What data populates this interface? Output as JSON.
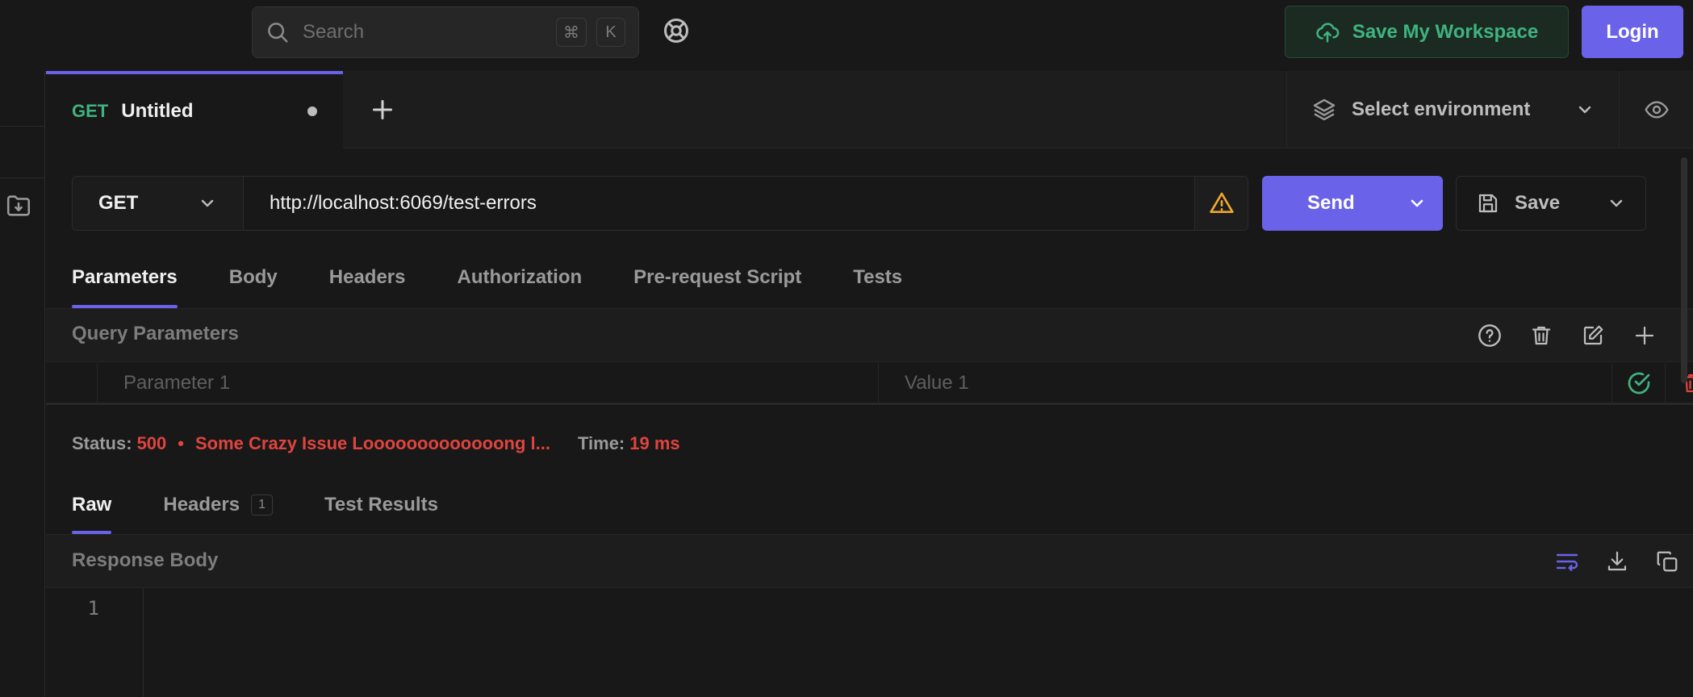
{
  "colors": {
    "accent": "#6a63ea",
    "method_get": "#3fb37f",
    "error": "#e0443e",
    "success": "#3fb37f"
  },
  "topbar": {
    "search_placeholder": "Search",
    "shortcut_keys": [
      "⌘",
      "K"
    ],
    "help_icon": "lifebuoy-icon",
    "save_workspace_label": "Save My Workspace",
    "login_label": "Login"
  },
  "tabs": [
    {
      "method": "GET",
      "title": "Untitled",
      "active": true,
      "unsaved": true
    }
  ],
  "environment": {
    "label": "Select environment"
  },
  "request": {
    "method": "GET",
    "url": "http://localhost:6069/test-errors",
    "send_label": "Send",
    "save_label": "Save"
  },
  "request_tabs": [
    "Parameters",
    "Body",
    "Headers",
    "Authorization",
    "Pre-request Script",
    "Tests"
  ],
  "query_parameters": {
    "title": "Query Parameters",
    "row": {
      "key_placeholder": "Parameter 1",
      "value_placeholder": "Value 1"
    }
  },
  "response": {
    "status_label": "Status:",
    "status_code": "500",
    "status_bullet": "•",
    "status_text": "Some Crazy Issue Looooooooooooong l...",
    "time_label": "Time:",
    "time_value": "19 ms",
    "tabs": [
      {
        "label": "Raw",
        "active": true
      },
      {
        "label": "Headers",
        "badge": "1"
      },
      {
        "label": "Test Results"
      }
    ],
    "body_title": "Response Body",
    "line_numbers": [
      "1"
    ]
  }
}
